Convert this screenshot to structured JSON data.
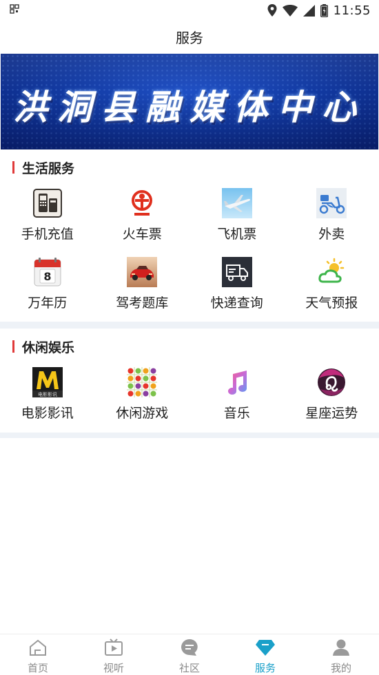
{
  "status_bar": {
    "time": "11:55"
  },
  "header": {
    "title": "服务"
  },
  "banner": {
    "text": "洪洞县融媒体中心"
  },
  "sections": [
    {
      "title": "生活服务",
      "items": [
        {
          "label": "手机充值",
          "icon": "phone-recharge-icon"
        },
        {
          "label": "火车票",
          "icon": "railway-icon"
        },
        {
          "label": "飞机票",
          "icon": "airplane-icon"
        },
        {
          "label": "外卖",
          "icon": "delivery-scooter-icon"
        },
        {
          "label": "万年历",
          "icon": "calendar-icon"
        },
        {
          "label": "驾考题库",
          "icon": "car-icon"
        },
        {
          "label": "快递查询",
          "icon": "delivery-truck-icon"
        },
        {
          "label": "天气预报",
          "icon": "weather-icon"
        }
      ]
    },
    {
      "title": "休闲娱乐",
      "items": [
        {
          "label": "电影影讯",
          "icon": "movie-icon",
          "icon_caption": "电影影讯"
        },
        {
          "label": "休闲游戏",
          "icon": "fruit-game-icon"
        },
        {
          "label": "音乐",
          "icon": "music-note-icon"
        },
        {
          "label": "星座运势",
          "icon": "zodiac-icon"
        }
      ]
    }
  ],
  "calendar_icon_number": "8",
  "tabs": [
    {
      "label": "首页",
      "icon": "home-icon",
      "active": false
    },
    {
      "label": "视听",
      "icon": "tv-icon",
      "active": false
    },
    {
      "label": "社区",
      "icon": "chat-icon",
      "active": false
    },
    {
      "label": "服务",
      "icon": "diamond-icon",
      "active": true
    },
    {
      "label": "我的",
      "icon": "user-icon",
      "active": false
    }
  ],
  "colors": {
    "accent": "#1aa0c9",
    "section_marker": "#e03a3a",
    "banner_blue": "#123aa3",
    "divider": "#eef2f7"
  }
}
